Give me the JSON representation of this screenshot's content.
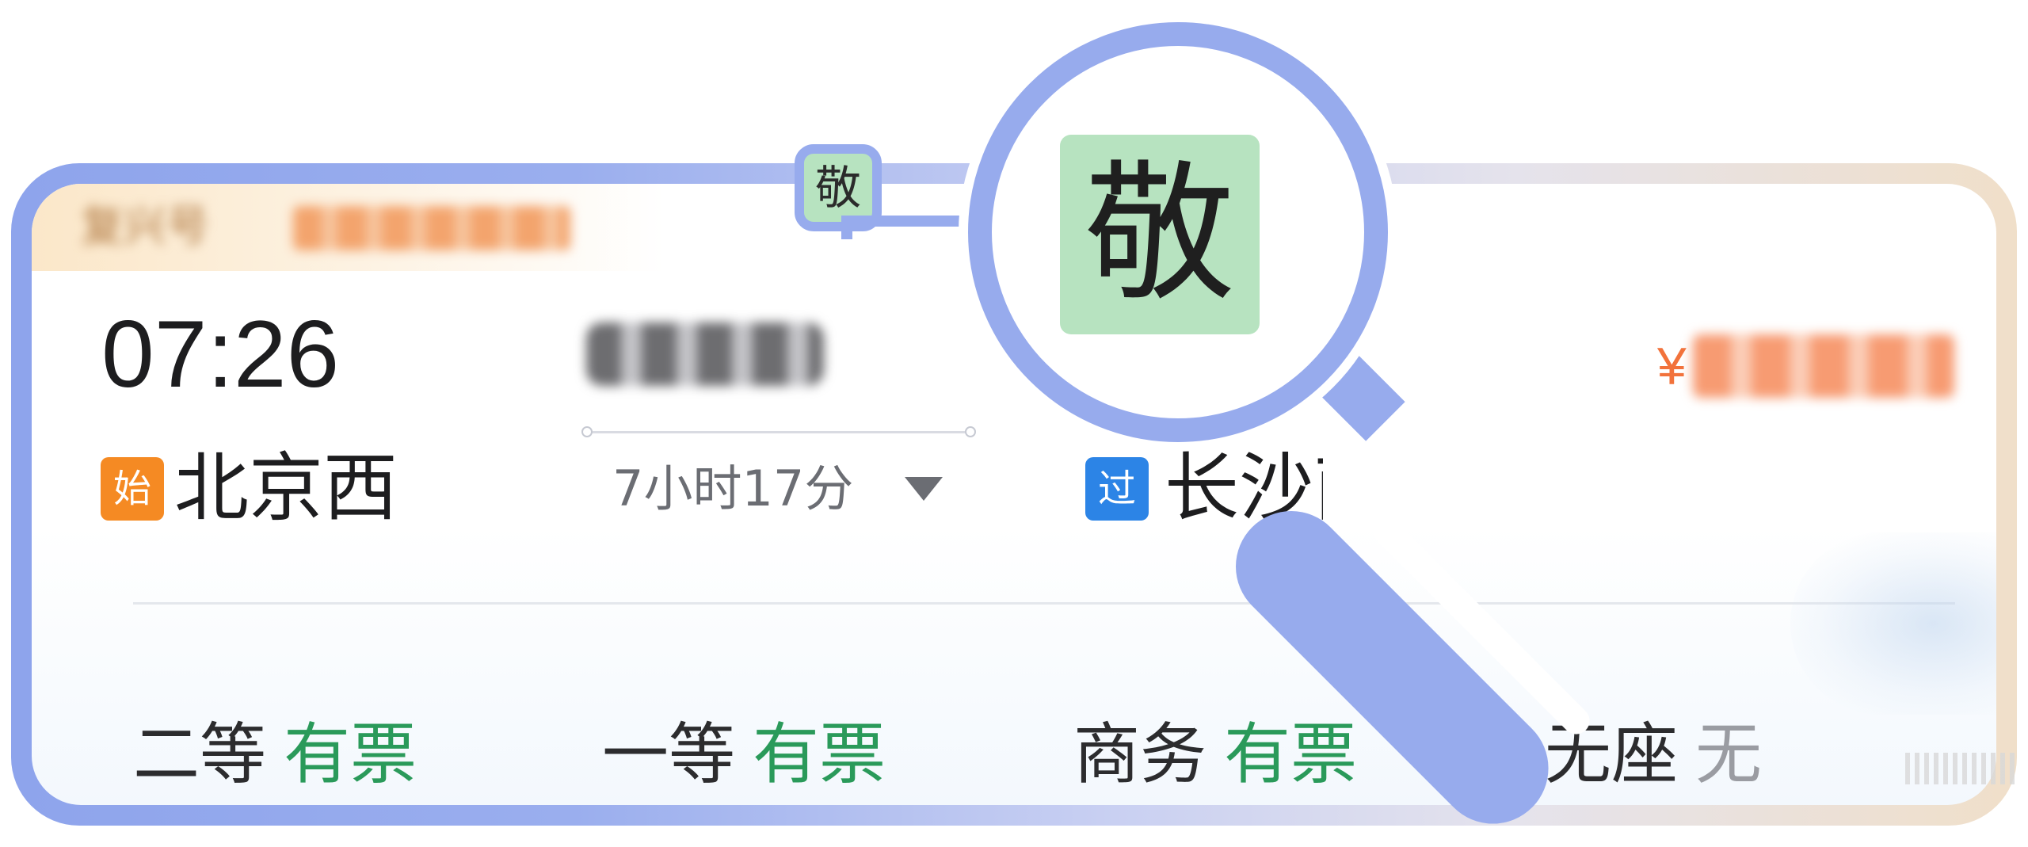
{
  "ticket": {
    "train_name": "复兴号",
    "departure_time": "07:26",
    "departure_tag": "始",
    "departure_station": "北京西",
    "duration": "7小时17分",
    "arrival_tag": "过",
    "arrival_station": "长沙南",
    "priority_tag": "敬",
    "price_symbol": "¥"
  },
  "seats": [
    {
      "class": "二等",
      "status": "有票"
    },
    {
      "class": "一等",
      "status": "有票"
    },
    {
      "class": "商务",
      "status": "有票"
    },
    {
      "class": "无座",
      "status": "无"
    }
  ],
  "magnifier": {
    "text": "敬"
  },
  "colors": {
    "accent_blue": "#97abed",
    "available_green": "#2a9a5a",
    "price_orange": "#f2723b",
    "start_tag": "#f58a23",
    "pass_tag": "#2c84e6",
    "priority_tag_bg": "#b7e3c0"
  }
}
